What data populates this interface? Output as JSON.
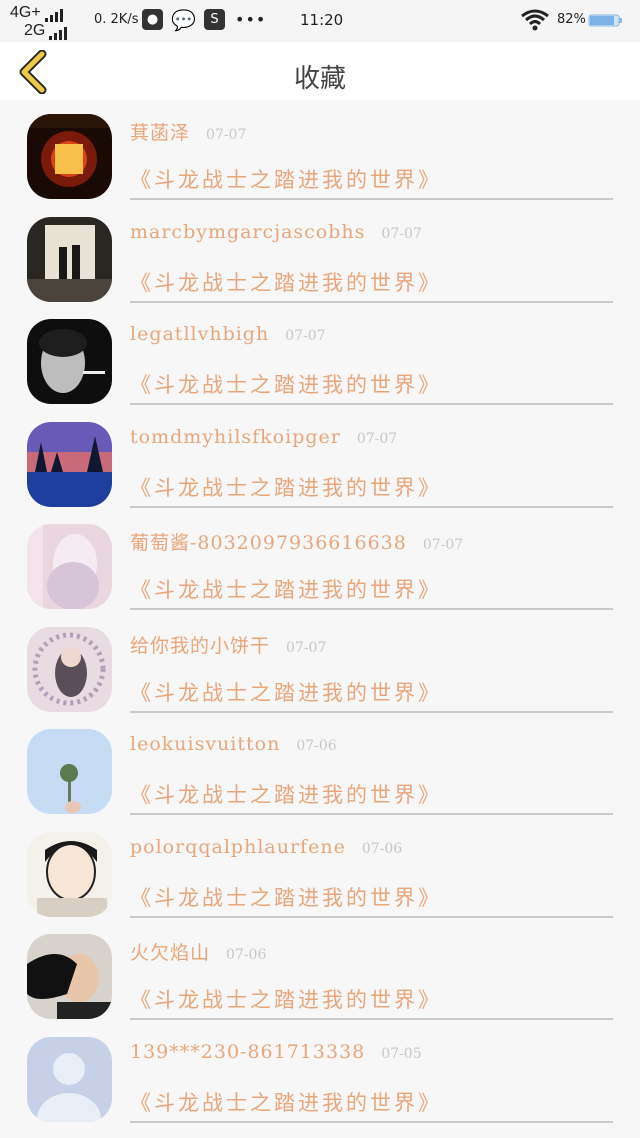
{
  "status_bar": {
    "network_1": "4G+",
    "network_2": "2G",
    "speed": "0. 2K/s",
    "time": "11:20",
    "battery": "82%",
    "app_icons": [
      "qq-icon",
      "wechat-icon",
      "s-app-icon"
    ]
  },
  "nav": {
    "title": "收藏",
    "back_icon": "chevron-left-icon"
  },
  "colors": {
    "accent": "#e8a67a",
    "date": "#c8c8c8",
    "back": "#f0c94a"
  },
  "favorites": [
    {
      "name": "萁菡泽",
      "date": "07-07",
      "title": "《斗龙战士之踏进我的世界》"
    },
    {
      "name": "marcbymgarcjascobhs",
      "date": "07-07",
      "title": "《斗龙战士之踏进我的世界》"
    },
    {
      "name": "legatllvhbigh",
      "date": "07-07",
      "title": "《斗龙战士之踏进我的世界》"
    },
    {
      "name": "tomdmyhilsfkoipger",
      "date": "07-07",
      "title": "《斗龙战士之踏进我的世界》"
    },
    {
      "name": "葡萄酱-8032097936616638",
      "date": "07-07",
      "title": "《斗龙战士之踏进我的世界》"
    },
    {
      "name": "给你我的小饼干",
      "date": "07-07",
      "title": "《斗龙战士之踏进我的世界》"
    },
    {
      "name": "leokuisvuitton",
      "date": "07-06",
      "title": "《斗龙战士之踏进我的世界》"
    },
    {
      "name": "polorqqalphlaurfene",
      "date": "07-06",
      "title": "《斗龙战士之踏进我的世界》"
    },
    {
      "name": "火欠焰山",
      "date": "07-06",
      "title": "《斗龙战士之踏进我的世界》"
    },
    {
      "name": "139***230-861713338",
      "date": "07-05",
      "title": "《斗龙战士之踏进我的世界》"
    }
  ]
}
